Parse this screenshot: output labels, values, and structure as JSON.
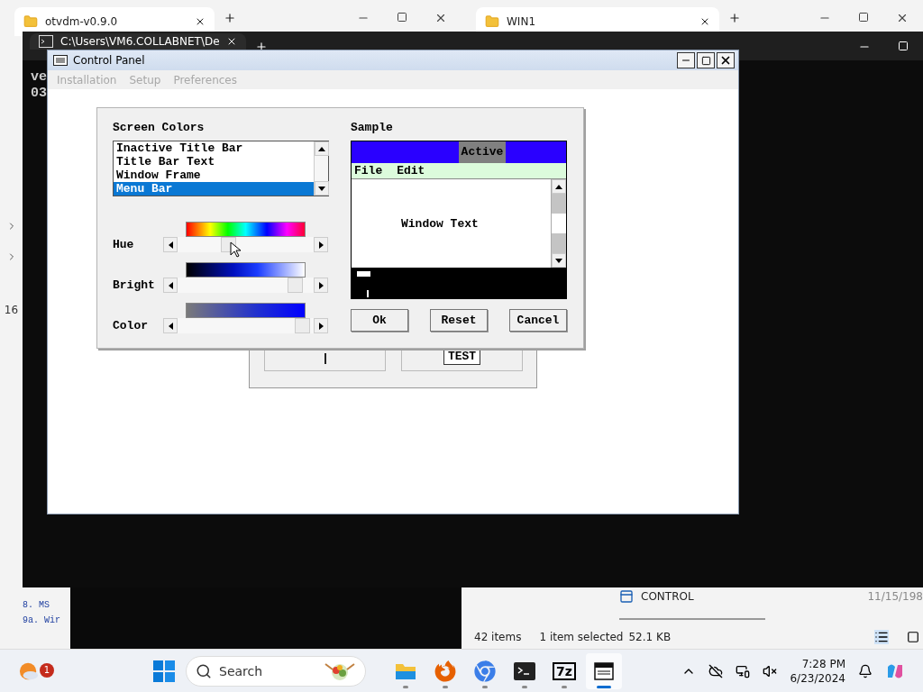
{
  "explorer_left": {
    "tab_title": "otvdm-v0.9.0",
    "count": "16",
    "lines": [
      "8. MS",
      "9a. Wir"
    ]
  },
  "explorer_right": {
    "tab_title": "WIN1",
    "file": {
      "name": "CONTROL",
      "date": "11/15/198"
    },
    "status": {
      "count": "42 items",
      "selection": "1 item selected",
      "size": "52.1 KB"
    }
  },
  "terminal": {
    "tab_title": "C:\\Users\\VM6.COLLABNET\\De",
    "lines": [
      "ve",
      "03"
    ]
  },
  "control_panel": {
    "title": "Control Panel",
    "menu": [
      {
        "label": "Installation",
        "disabled": true
      },
      {
        "label": "Setup",
        "disabled": true
      },
      {
        "label": "Preferences",
        "disabled": true
      }
    ],
    "back_dialog": {
      "field_text": "TEST"
    },
    "dialog": {
      "list_label": "Screen Colors",
      "items": [
        {
          "label": "Inactive Title Bar",
          "selected": false
        },
        {
          "label": "Title Bar Text",
          "selected": false
        },
        {
          "label": "Window Frame",
          "selected": false
        },
        {
          "label": "Menu Bar",
          "selected": true
        }
      ],
      "sliders": [
        {
          "label": "Hue",
          "kind": "hue",
          "level": 0.36
        },
        {
          "label": "Bright",
          "kind": "bright",
          "level": 0.91
        },
        {
          "label": "Color",
          "kind": "saturation",
          "level": 0.97
        }
      ],
      "sample_label": "Sample",
      "sample": {
        "title": "Active",
        "menu": [
          "File",
          "Edit"
        ],
        "text": "Window Text"
      },
      "buttons": [
        "Ok",
        "Reset",
        "Cancel"
      ]
    }
  },
  "taskbar": {
    "notification_count": "1",
    "search_placeholder": "Search",
    "apps": [
      {
        "kind": "files",
        "selected": false
      },
      {
        "kind": "firefox",
        "selected": false
      },
      {
        "kind": "chrome",
        "selected": false
      },
      {
        "kind": "terminal",
        "selected": false
      },
      {
        "kind": "archiver",
        "label": "7z",
        "selected": false
      },
      {
        "kind": "control",
        "selected": true
      }
    ],
    "time": "7:28 PM",
    "date": "6/23/2024"
  }
}
